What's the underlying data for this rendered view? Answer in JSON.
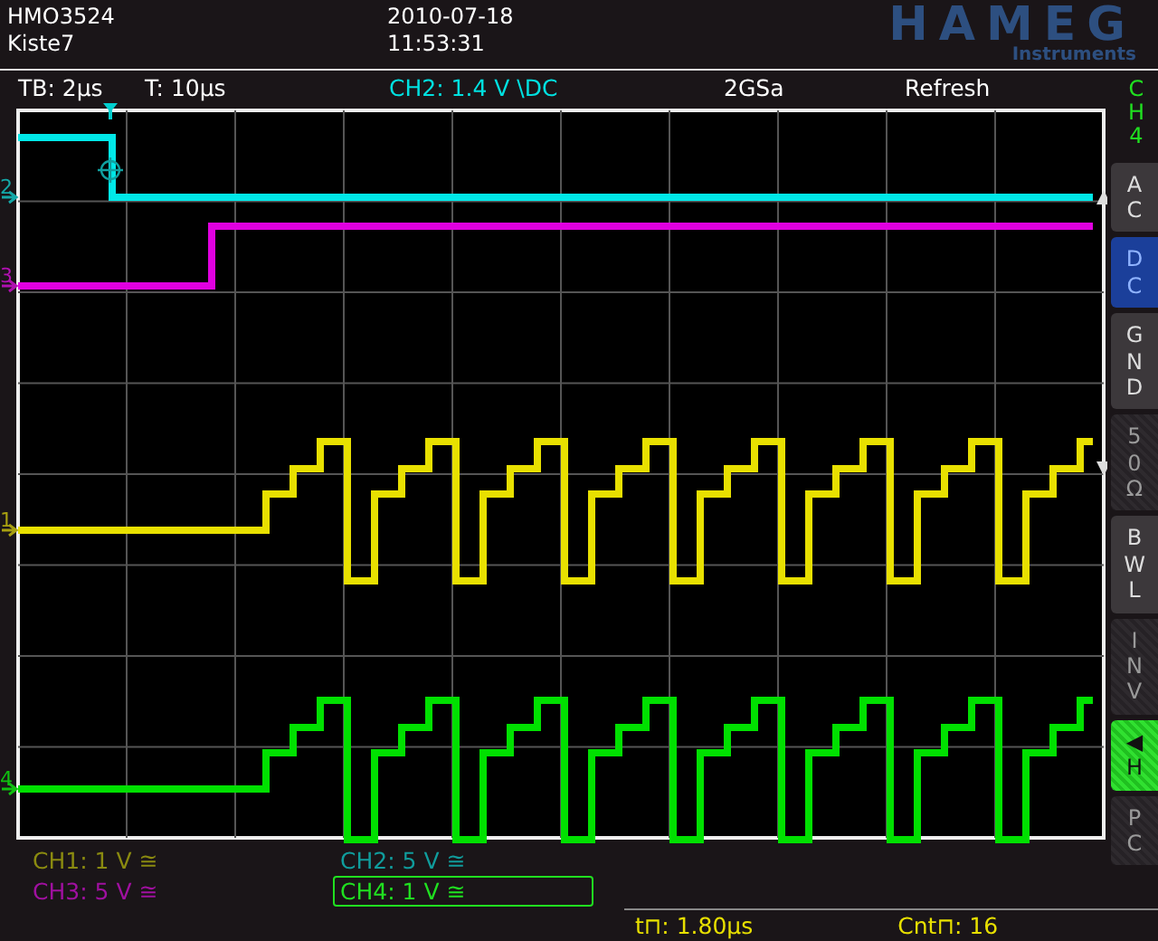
{
  "header": {
    "model": "HMO3524",
    "file": "Kiste7",
    "date": "2010-07-18",
    "time": "11:53:31",
    "logo": "HAMEG",
    "logo_subtitle": "Instruments"
  },
  "status_bar": {
    "timebase": "TB: 2µs",
    "trigger_time": "T: 10µs",
    "trigger": "CH2: 1.4 V \\DC",
    "sample_rate": "2GSa",
    "mode": "Refresh"
  },
  "markers": [
    {
      "label": "2",
      "color": "#14a8a8"
    },
    {
      "label": "3",
      "color": "#b010b0"
    },
    {
      "label": "1",
      "color": "#a8a010"
    },
    {
      "label": "4",
      "color": "#10c010"
    }
  ],
  "side_panel": {
    "channel": "CH4",
    "buttons": [
      {
        "label": "AC",
        "selected": false,
        "disabled": false,
        "lit": false
      },
      {
        "label": "DC",
        "selected": true,
        "disabled": false,
        "lit": false
      },
      {
        "label": "GND",
        "selected": false,
        "disabled": false,
        "lit": false
      },
      {
        "label": "50Ω",
        "selected": false,
        "disabled": true,
        "lit": false
      },
      {
        "label": "BWL",
        "selected": false,
        "disabled": false,
        "lit": false
      },
      {
        "label": "INV",
        "selected": false,
        "disabled": true,
        "lit": false
      },
      {
        "label": "◀H",
        "selected": false,
        "disabled": false,
        "lit": true
      },
      {
        "label": "PC",
        "selected": false,
        "disabled": true,
        "lit": false
      }
    ]
  },
  "channels": [
    {
      "label": "CH1: 1 V ≅",
      "color": "#8a8a10",
      "selected": false
    },
    {
      "label": "CH2: 5 V ≅",
      "color": "#109c9c",
      "selected": false
    },
    {
      "label": "CH3: 5 V ≅",
      "color": "#a010a0",
      "selected": false
    },
    {
      "label": "CH4: 1 V ≅",
      "color": "#20e020",
      "selected": true
    }
  ],
  "readouts": [
    "t⊓: 1.80µs",
    "Cnt⊓: 16"
  ]
}
